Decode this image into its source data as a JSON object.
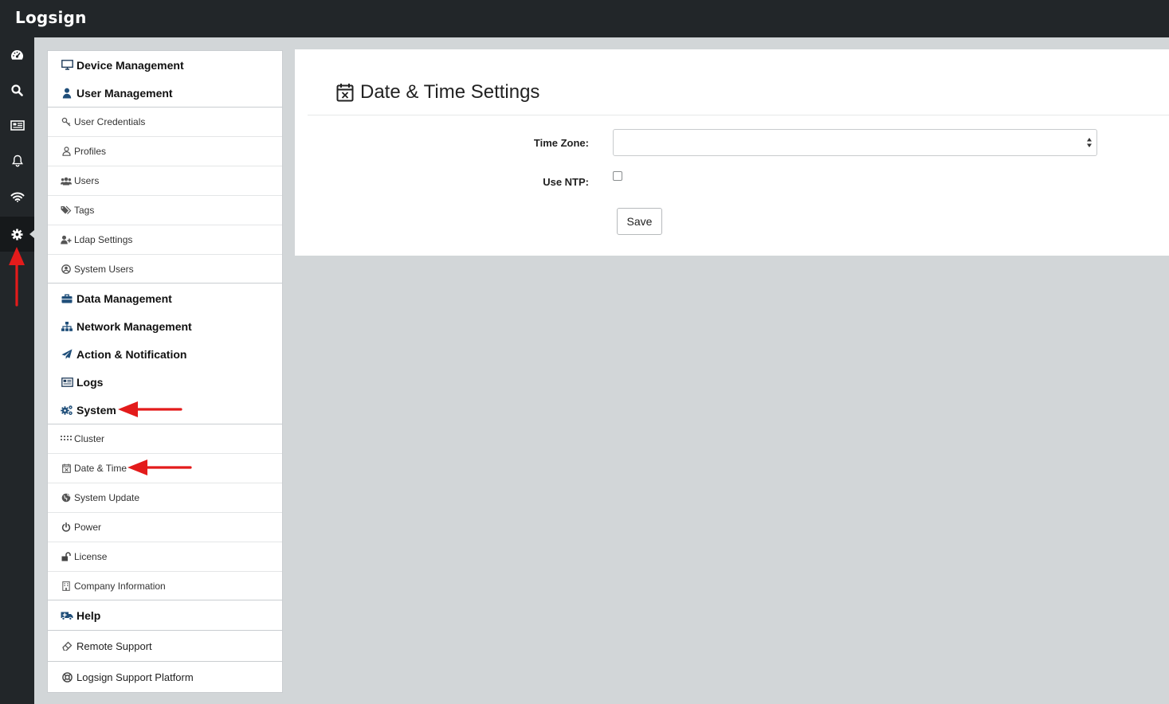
{
  "app": {
    "brand": "Logsign"
  },
  "rail": {
    "items": [
      {
        "icon": "dashboard-icon"
      },
      {
        "icon": "search-icon"
      },
      {
        "icon": "newspaper-icon"
      },
      {
        "icon": "bell-icon"
      },
      {
        "icon": "wifi-icon"
      },
      {
        "icon": "gear-icon",
        "active": true
      }
    ]
  },
  "settings_menu": {
    "device_management": "Device Management",
    "user_management": "User Management",
    "user_sub": [
      "User Credentials",
      "Profiles",
      "Users",
      "Tags",
      "Ldap Settings",
      "System Users"
    ],
    "data_management": "Data Management",
    "network_management": "Network Management",
    "action_notification": "Action & Notification",
    "logs": "Logs",
    "system": "System",
    "system_sub": [
      "Cluster",
      "Date & Time",
      "System Update",
      "Power",
      "License",
      "Company Information"
    ],
    "help": "Help",
    "help_links": [
      "Remote Support",
      "Logsign Support Platform"
    ]
  },
  "page": {
    "title": "Date & Time Settings",
    "time_zone_label": "Time Zone:",
    "time_zone_value": "",
    "use_ntp_label": "Use NTP:",
    "use_ntp_checked": false,
    "save_label": "Save"
  },
  "colors": {
    "topbar": "#222629",
    "accent_icon": "#1f4e79",
    "annotation_arrow": "#e31b1b"
  }
}
